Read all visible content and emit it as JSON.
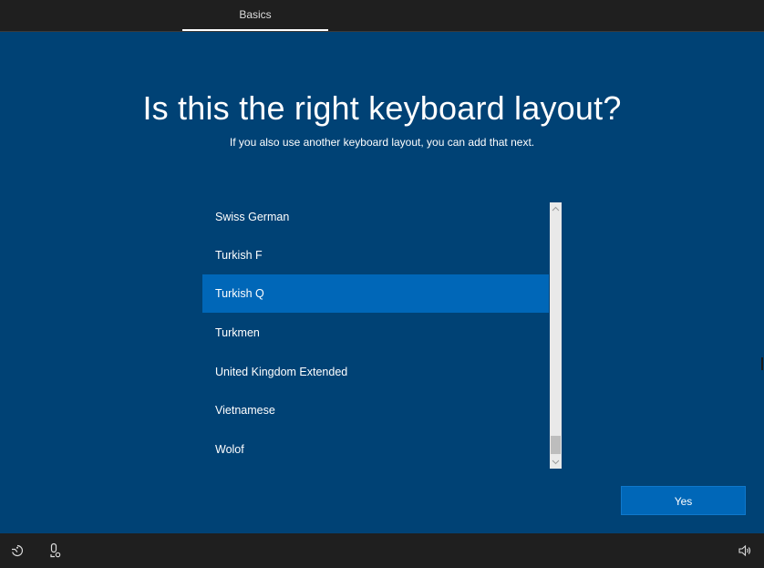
{
  "header": {
    "tab_label": "Basics"
  },
  "main": {
    "title": "Is this the right keyboard layout?",
    "subtitle": "If you also use another keyboard layout, you can add that next."
  },
  "layouts": {
    "items": [
      {
        "label": "Swiss German",
        "selected": false
      },
      {
        "label": "Turkish F",
        "selected": false
      },
      {
        "label": "Turkish Q",
        "selected": true
      },
      {
        "label": "Turkmen",
        "selected": false
      },
      {
        "label": "United Kingdom Extended",
        "selected": false
      },
      {
        "label": "Vietnamese",
        "selected": false
      },
      {
        "label": "Wolof",
        "selected": false
      }
    ]
  },
  "actions": {
    "yes_label": "Yes"
  },
  "bottom_bar": {
    "icons": [
      "ease-of-access-icon",
      "microphone-icon",
      "volume-icon"
    ]
  },
  "colors": {
    "background": "#004275",
    "selection": "#0067b8",
    "bar": "#1f1f1f"
  }
}
